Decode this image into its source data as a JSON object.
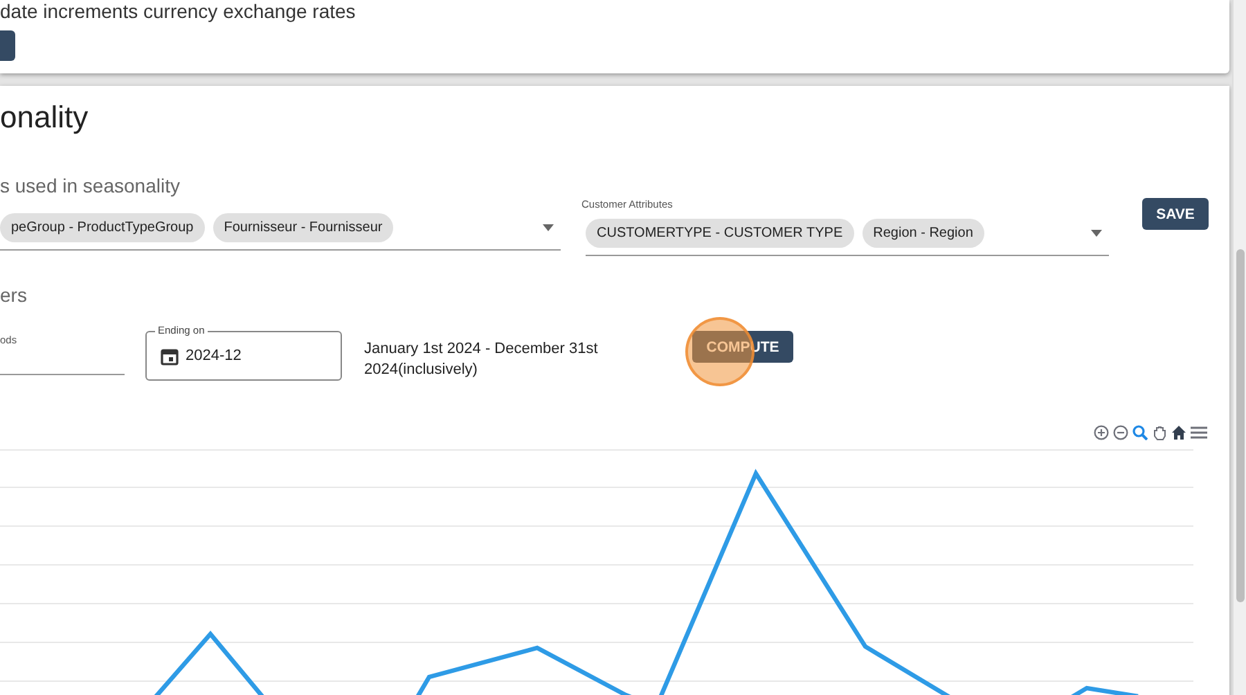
{
  "top_card": {
    "description": "date increments currency exchange rates"
  },
  "section": {
    "title": "onality",
    "subtitle": "s used in seasonality"
  },
  "product_attributes": {
    "chips": [
      "peGroup - ProductTypeGroup",
      "Fournisseur - Fournisseur"
    ]
  },
  "customer_attributes": {
    "label": "Customer Attributes",
    "chips": [
      "CUSTOMERTYPE - CUSTOMER TYPE",
      "Region - Region"
    ]
  },
  "save_button": "SAVE",
  "parameters": {
    "heading": "ers",
    "periods_label": "ods",
    "ending_label": "Ending on",
    "ending_value": "2024-12",
    "range_text": "January 1st 2024 - December 31st 2024(inclusively)",
    "compute_button": "COMPUTE"
  }
}
